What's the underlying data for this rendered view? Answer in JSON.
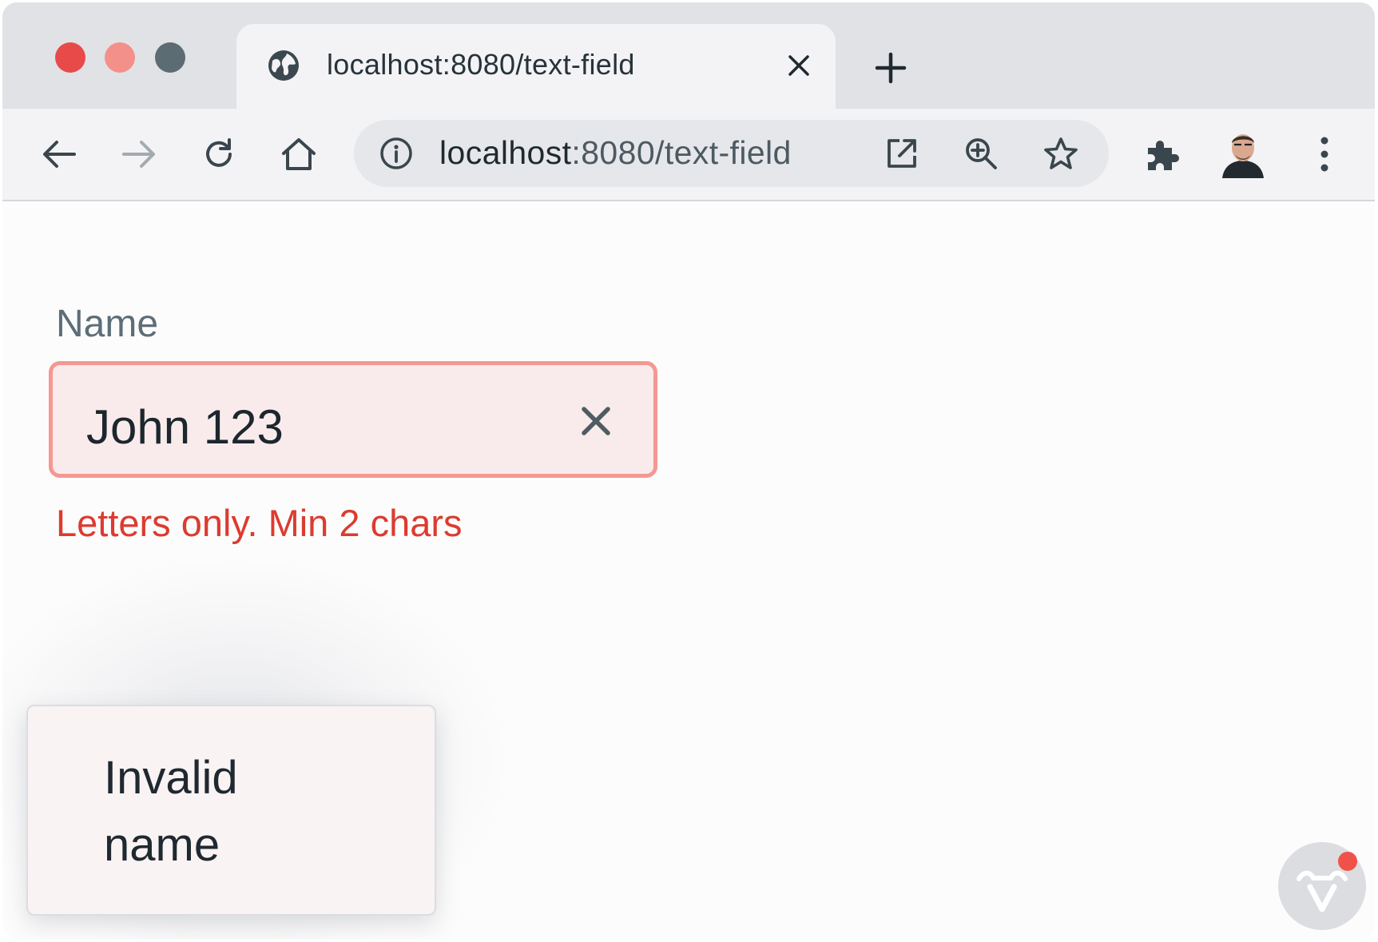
{
  "browser": {
    "tab": {
      "title": "localhost:8080/text-field",
      "icon": "globe-icon"
    },
    "address_bar": {
      "host": "localhost",
      "path": ":8080/text-field"
    },
    "traffic_light_colors": [
      "#e84a4a",
      "#f4908a",
      "#5b6c72"
    ]
  },
  "form": {
    "name_field": {
      "label": "Name",
      "value": "John 123",
      "error_message": "Letters only. Min 2 chars",
      "invalid": true
    }
  },
  "notification": {
    "message": "Invalid name"
  },
  "colors": {
    "error": "#dc3b30",
    "field_border_invalid": "#f49891",
    "field_background_invalid": "#f9ebec"
  }
}
